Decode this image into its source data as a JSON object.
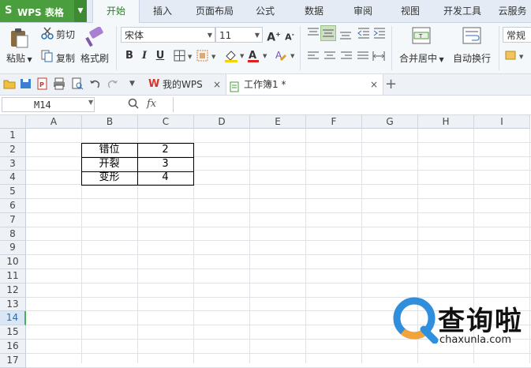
{
  "app": {
    "logo_glyph": "S",
    "title": "WPS 表格"
  },
  "ribbon_tabs": [
    {
      "label": "开始",
      "active": true
    },
    {
      "label": "插入"
    },
    {
      "label": "页面布局"
    },
    {
      "label": "公式"
    },
    {
      "label": "数据"
    },
    {
      "label": "审阅"
    },
    {
      "label": "视图"
    },
    {
      "label": "开发工具"
    },
    {
      "label": "云服务"
    }
  ],
  "ribbon": {
    "paste_label": "粘贴",
    "cut_label": "剪切",
    "copy_label": "复制",
    "format_painter_label": "格式刷",
    "font_name": "宋体",
    "font_size": "11",
    "grow_font": "A",
    "shrink_font": "A",
    "bold": "B",
    "italic": "I",
    "underline": "U",
    "merge_label": "合并居中",
    "wrap_label": "自动换行",
    "number_format": "常规"
  },
  "doc_tabs": [
    {
      "label": "我的WPS"
    },
    {
      "label": "工作簿1 *",
      "active": true
    }
  ],
  "formula_bar": {
    "name_box": "M14",
    "fx_label": "fx",
    "value": ""
  },
  "columns": [
    "A",
    "B",
    "C",
    "D",
    "E",
    "F",
    "G",
    "H",
    "I"
  ],
  "rows": [
    "1",
    "2",
    "3",
    "4",
    "5",
    "6",
    "7",
    "8",
    "9",
    "10",
    "11",
    "12",
    "13",
    "14",
    "15",
    "16",
    "17"
  ],
  "selected_row": "14",
  "table": [
    {
      "label": "错位",
      "value": "2"
    },
    {
      "label": "开裂",
      "value": "3"
    },
    {
      "label": "变形",
      "value": "4"
    }
  ],
  "watermark": {
    "title": "查询啦",
    "url": "chaxunla.com"
  },
  "colors": {
    "accent_green": "#4a9e3d",
    "wps_red": "#d9342b",
    "watermark_blue": "#2f8fdc",
    "watermark_orange": "#f2a33a"
  }
}
